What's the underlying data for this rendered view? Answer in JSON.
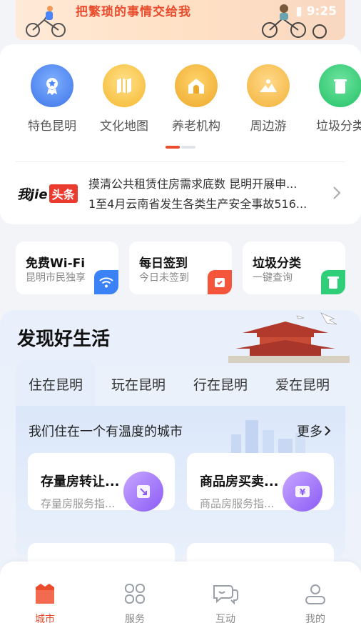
{
  "banner": {
    "text": "把繁琐的事情交给我"
  },
  "status": {
    "time": "9:25"
  },
  "services": [
    {
      "label": "特色昆明",
      "icon": "medal-icon",
      "color": "#4a86f7"
    },
    {
      "label": "文化地图",
      "icon": "map-icon",
      "color": "#f5c23e"
    },
    {
      "label": "养老机构",
      "icon": "home-icon",
      "color": "#f0b429"
    },
    {
      "label": "周边游",
      "icon": "mountain-icon",
      "color": "#f6b93b"
    },
    {
      "label": "垃圾分类",
      "icon": "recycle-bin-icon",
      "color": "#2ecc71"
    }
  ],
  "news": {
    "brand": "我jie",
    "tag": "头条",
    "lines": [
      "摸清公共租赁住房需求底数 昆明开展申...",
      "1至4月云南省发生各类生产安全事故516..."
    ]
  },
  "quick": [
    {
      "title": "免费Wi-Fi",
      "sub": "昆明市民独享",
      "icon": "wifi-icon",
      "color": "#3b82f6"
    },
    {
      "title": "每日签到",
      "sub": "今日未签到",
      "icon": "calendar-check-icon",
      "color": "#f4553b"
    },
    {
      "title": "垃圾分类",
      "sub": "一键查询",
      "icon": "recycle-bin-icon",
      "color": "#2fcf79"
    }
  ],
  "discover": {
    "title": "发现好生活",
    "tabs": [
      "住在昆明",
      "玩在昆明",
      "行在昆明",
      "爱在昆明"
    ],
    "panel_title": "我们住在一个有温度的城市",
    "more": "更多",
    "cards": [
      {
        "title": "存量房转让...",
        "sub": "存量房服务指...",
        "icon": "transfer-icon"
      },
      {
        "title": "商品房买卖...",
        "sub": "商品房服务指...",
        "icon": "yen-icon"
      }
    ]
  },
  "tabbar": [
    {
      "label": "城市",
      "icon": "city-icon",
      "active": true
    },
    {
      "label": "服务",
      "icon": "service-grid-icon",
      "active": false
    },
    {
      "label": "互动",
      "icon": "chat-icon",
      "active": false
    },
    {
      "label": "我的",
      "icon": "profile-icon",
      "active": false
    }
  ],
  "colors": {
    "accent": "#ea4d2e",
    "primary_blue": "#4a86f7"
  }
}
